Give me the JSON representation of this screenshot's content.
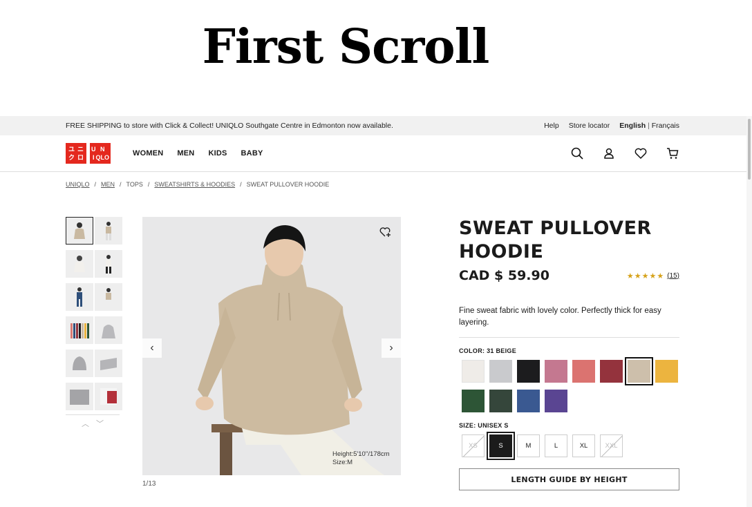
{
  "heading": "First Scroll",
  "topbar": {
    "promo": "FREE SHIPPING to store with Click & Collect! UNIQLO Southgate Centre in Edmonton now available.",
    "help": "Help",
    "store_locator": "Store locator",
    "lang_english": "English",
    "lang_sep": "|",
    "lang_french": "Français"
  },
  "logo": {
    "top": [
      "ユ",
      "ニ",
      "ク",
      "ロ"
    ],
    "bottom": [
      "U",
      "N",
      "I",
      "QLO"
    ],
    "color": "#e4281e"
  },
  "nav": [
    "WOMEN",
    "MEN",
    "KIDS",
    "BABY"
  ],
  "breadcrumb": [
    "UNIQLO",
    "MEN",
    "TOPS",
    "SWEATSHIRTS & HOODIES",
    "SWEAT PULLOVER HOODIE"
  ],
  "breadcrumb_sep": "/",
  "gallery": {
    "caption_height": "Height:5'10''/178cm",
    "caption_size": "Size:M",
    "counter": "1/13",
    "prev": "‹",
    "next": "›",
    "thumb_up": "︿",
    "thumb_down": "﹀"
  },
  "product": {
    "title": "SWEAT PULLOVER HOODIE",
    "price": "CAD $ 59.90",
    "stars": "★★★★★",
    "rating_value": 4.5,
    "review_count": "(15)",
    "description": "Fine sweat fabric with lovely color. Perfectly thick for easy layering.",
    "color_label": "COLOR: 31 BEIGE",
    "colors": [
      "#efece8",
      "#c9cacd",
      "#1c1c1e",
      "#c47890",
      "#db7370",
      "#94333d",
      "#cdbfab",
      "#ecb43f",
      "#2d5536",
      "#35463b",
      "#3a5991",
      "#5a4592"
    ],
    "selected_color_index": 6,
    "size_label": "SIZE: UNISEX S",
    "sizes": [
      "XS",
      "S",
      "M",
      "L",
      "XL",
      "XXL"
    ],
    "disabled_sizes": [
      "XS",
      "XXL"
    ],
    "selected_size": "S",
    "length_guide": "LENGTH GUIDE BY HEIGHT"
  }
}
